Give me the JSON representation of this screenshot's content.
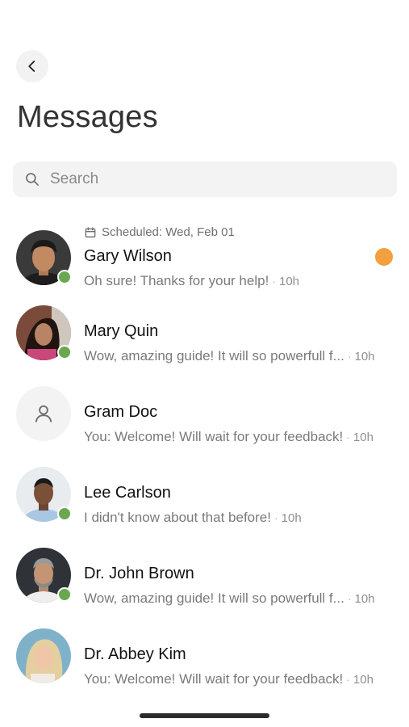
{
  "header": {
    "title": "Messages"
  },
  "search": {
    "placeholder": "Search"
  },
  "colors": {
    "online": "#6aa84f",
    "unread": "#f2a03d"
  },
  "conversations": [
    {
      "scheduled": "Scheduled: Wed, Feb 01",
      "name": "Gary Wilson",
      "message": "Oh sure! Thanks for your help!",
      "time": "10h",
      "online": true,
      "unread": true
    },
    {
      "name": "Mary Quin",
      "message": "Wow, amazing guide! It will so powerfull f...",
      "time": "10h",
      "online": true
    },
    {
      "name": "Gram Doc",
      "message": "You: Welcome! Will wait for your feedback!",
      "time": "10h",
      "online": false
    },
    {
      "name": "Lee Carlson",
      "message": "I didn't know about that before!",
      "time": "10h",
      "online": true
    },
    {
      "name": "Dr. John Brown",
      "message": "Wow, amazing guide! It will so powerfull f...",
      "time": "10h",
      "online": true
    },
    {
      "name": "Dr. Abbey Kim",
      "message": "You: Welcome! Will wait for your feedback!",
      "time": "10h",
      "online": false
    }
  ],
  "separator": "·"
}
